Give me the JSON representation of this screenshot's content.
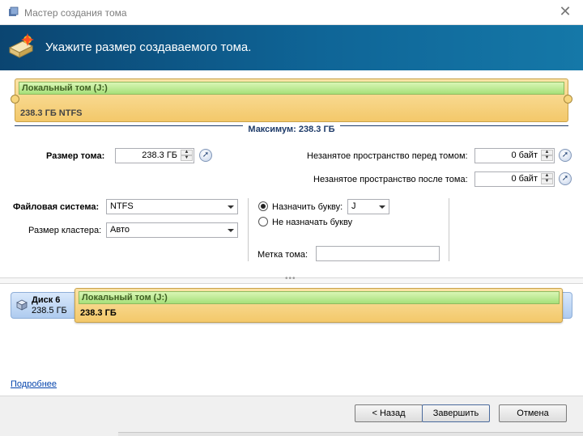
{
  "window": {
    "title": "Мастер создания тома"
  },
  "header": {
    "title": "Укажите размер создаваемого тома."
  },
  "partition_bar": {
    "volume_name": "Локальный том (J:)",
    "volume_info": "238.3 ГБ NTFS",
    "maximum_label": "Максимум: 238.3 ГБ"
  },
  "form": {
    "volume_size_label": "Размер тома:",
    "volume_size_value": "238.3 ГБ",
    "free_before_label": "Незанятое пространство перед томом:",
    "free_before_value": "0 байт",
    "free_after_label": "Незанятое пространство после тома:",
    "free_after_value": "0 байт",
    "filesystem_label": "Файловая система:",
    "filesystem_value": "NTFS",
    "cluster_label": "Размер кластера:",
    "cluster_value": "Авто",
    "assign_letter_label": "Назначить букву:",
    "assign_letter_value": "J",
    "no_letter_label": "Не назначать букву",
    "volume_label_label": "Метка тома:",
    "volume_label_value": ""
  },
  "disk_map": {
    "disk_name": "Диск 6",
    "disk_size": "238.5 ГБ",
    "volume_name": "Локальный том (J:)",
    "volume_size": "238.3 ГБ"
  },
  "links": {
    "more": "Подробнее"
  },
  "buttons": {
    "back": "< Назад",
    "finish": "Завершить",
    "cancel": "Отмена"
  },
  "colors": {
    "banner": "#0f6597",
    "volume_fill": "#f3c86a",
    "volume_label": "#a6e07a",
    "disk_bar": "#aecbef"
  }
}
